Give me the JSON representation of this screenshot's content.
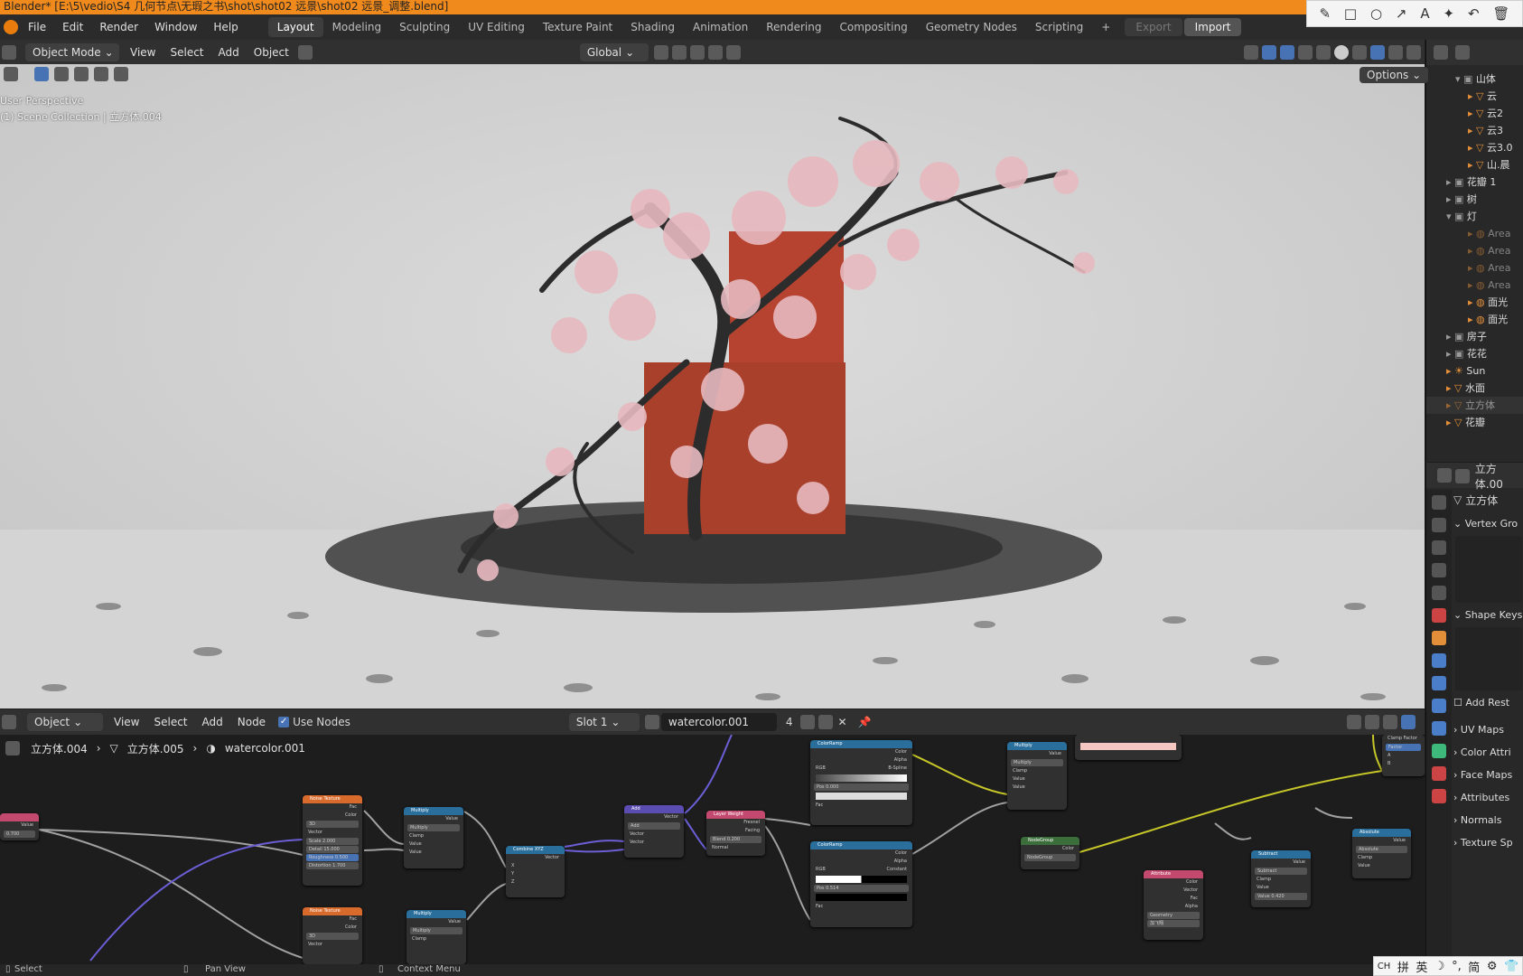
{
  "window": {
    "title": "Blender* [E:\\5\\vedio\\S4 几何节点\\无瑕之书\\shot\\shot02 远景\\shot02 远景_调整.blend]"
  },
  "menu": {
    "items": [
      "File",
      "Edit",
      "Render",
      "Window",
      "Help"
    ]
  },
  "workspaces": {
    "tabs": [
      "Layout",
      "Modeling",
      "Sculpting",
      "UV Editing",
      "Texture Paint",
      "Shading",
      "Animation",
      "Rendering",
      "Compositing",
      "Geometry Nodes",
      "Scripting"
    ],
    "active": "Layout",
    "add": "+",
    "export": "Export",
    "import": "Import"
  },
  "annotation_toolbar": {
    "tools": [
      "pencil-icon",
      "rectangle-icon",
      "circle-icon",
      "arrow-icon",
      "text-icon",
      "marker-icon",
      "undo-icon",
      "delete-icon"
    ],
    "glyphs": [
      "✎",
      "□",
      "○",
      "↗",
      "A",
      "✦",
      "↶",
      "🗑"
    ]
  },
  "viewport_header": {
    "mode": "Object Mode",
    "menus": [
      "View",
      "Select",
      "Add",
      "Object"
    ],
    "orientation": "Global",
    "options": "Options"
  },
  "viewport_overlay": {
    "line1": "User Perspective",
    "line2": "(1) Scene Collection | 立方体.004"
  },
  "scene": {
    "background": "#cfcfcf",
    "wall_color": "#b5432f",
    "blossom_color": "#e7b9bf",
    "trunk_color": "#2c2c2c"
  },
  "outliner": {
    "rows": [
      {
        "label": "山体",
        "type": "collection",
        "expanded": true
      },
      {
        "label": "云",
        "type": "mesh"
      },
      {
        "label": "云2",
        "type": "mesh"
      },
      {
        "label": "云3",
        "type": "mesh"
      },
      {
        "label": "云3.0",
        "type": "mesh"
      },
      {
        "label": "山.晨",
        "type": "mesh"
      },
      {
        "label": "花瓣 1",
        "type": "collection"
      },
      {
        "label": "树",
        "type": "collection"
      },
      {
        "label": "灯",
        "type": "collection",
        "expanded": true
      },
      {
        "label": "Area",
        "type": "light"
      },
      {
        "label": "Area",
        "type": "light"
      },
      {
        "label": "Area",
        "type": "light"
      },
      {
        "label": "Area",
        "type": "light"
      },
      {
        "label": "面光",
        "type": "light"
      },
      {
        "label": "面光",
        "type": "light"
      },
      {
        "label": "房子",
        "type": "collection"
      },
      {
        "label": "花花",
        "type": "collection"
      },
      {
        "label": "Sun",
        "type": "light"
      },
      {
        "label": "水面",
        "type": "mesh"
      },
      {
        "label": "立方体",
        "type": "mesh",
        "selected": true
      },
      {
        "label": "花瓣",
        "type": "mesh"
      }
    ]
  },
  "properties": {
    "object_name": "立方体.00",
    "mesh_name": "立方体",
    "panels": [
      "Vertex Gro",
      "Shape Keys",
      "UV Maps",
      "Color Attri",
      "Face Maps",
      "Attributes",
      "Normals",
      "Texture Sp"
    ],
    "add_rest": "Add Rest"
  },
  "node_header": {
    "object_type": "Object",
    "menus": [
      "View",
      "Select",
      "Add",
      "Node"
    ],
    "use_nodes": "Use Nodes",
    "slot": "Slot 1",
    "material": "watercolor.001",
    "users": "4"
  },
  "breadcrumb": {
    "items": [
      "立方体.004",
      "立方体.005",
      "watercolor.001"
    ]
  },
  "nodes": {
    "value": {
      "title": "",
      "label": "Value",
      "value": "0.700"
    },
    "noise1": {
      "title": "Noise Texture",
      "outputs": [
        "Fac",
        "Color"
      ],
      "dim": "3D",
      "inputs": [
        "Vector",
        "Scale 2.000",
        "Detail 15.000",
        "Roughness 0.500",
        "Distortion 1.700"
      ]
    },
    "noise2": {
      "title": "Noise Texture",
      "outputs": [
        "Fac",
        "Color"
      ],
      "dim": "3D",
      "inputs": [
        "Vector"
      ]
    },
    "mult1": {
      "title": "Multiply",
      "output": "Value",
      "mode": "Multiply",
      "clamp": "Clamp",
      "inputs": [
        "Value",
        "Value"
      ]
    },
    "mult2": {
      "title": "Multiply",
      "output": "Value",
      "mode": "Multiply",
      "clamp": "Clamp"
    },
    "combine": {
      "title": "Combine XYZ",
      "output": "Vector",
      "inputs": [
        "X",
        "Y",
        "Z"
      ]
    },
    "add": {
      "title": "Add",
      "output": "Vector",
      "mode": "Add",
      "inputs": [
        "Vector",
        "Vector"
      ]
    },
    "layer": {
      "title": "Layer Weight",
      "outputs": [
        "Fresnel",
        "Facing"
      ],
      "blend": "Blend 0.200",
      "normal": "Normal"
    },
    "ramp1": {
      "title": "ColorRamp",
      "outputs": [
        "Color",
        "Alpha"
      ],
      "mode": "RGB",
      "interp": "B-Spline",
      "pos": "Pos 0.000",
      "fac": "Fac"
    },
    "ramp2": {
      "title": "ColorRamp",
      "outputs": [
        "Color",
        "Alpha"
      ],
      "mode": "RGB",
      "interp": "Constant",
      "pos": "Pos 0.514",
      "fac": "Fac"
    },
    "mult3": {
      "title": "Multiply",
      "output": "Value",
      "mode": "Multiply",
      "clamp": "Clamp",
      "inputs": [
        "Value",
        "Value"
      ]
    },
    "nodegroup": {
      "title": "NodeGroup",
      "output": "Color",
      "group": "NodeGroup"
    },
    "attribute": {
      "title": "Attribute",
      "outputs": [
        "Color",
        "Vector",
        "Fac",
        "Alpha"
      ],
      "type": "Geometry",
      "name": "加飞翔"
    },
    "subtract": {
      "title": "Subtract",
      "output": "Value",
      "mode": "Subtract",
      "clamp": "Clamp",
      "inputs": [
        "Value",
        "Value 0.420"
      ]
    },
    "absolute": {
      "title": "Absolute",
      "output": "Value",
      "mode": "Absolute",
      "clamp": "Clamp",
      "inputs": [
        "Value"
      ]
    },
    "mixrgb": {
      "title": "",
      "rows": [
        "Clamp Factor",
        "Factor",
        "A",
        "B"
      ]
    },
    "color_pink": {
      "color": "#f4c7c3"
    }
  },
  "statusbar": {
    "select": "Select",
    "pan": "Pan View",
    "context": "Context Menu"
  },
  "ime": {
    "items": [
      "CH",
      "拼",
      "英",
      "☽",
      "°,",
      "简",
      "⚙",
      "👕"
    ]
  }
}
